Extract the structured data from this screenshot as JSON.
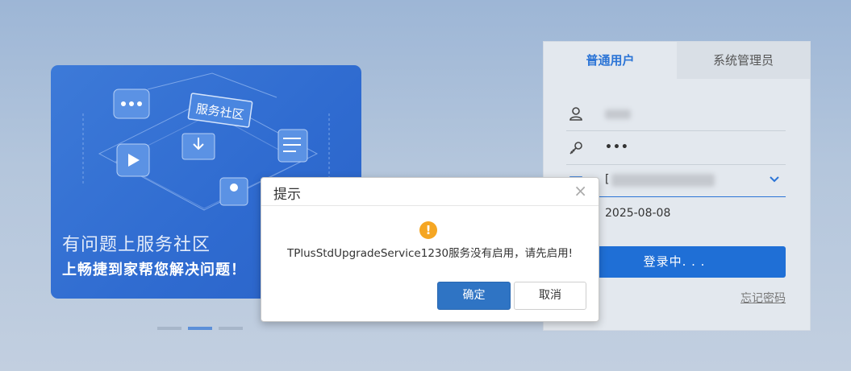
{
  "banner": {
    "badge_text": "服务社区",
    "title": "有问题上服务社区",
    "subtitle": "上畅捷到家帮您解决问题！"
  },
  "carousel": {
    "count": 3,
    "active_index": 1
  },
  "login": {
    "tabs": [
      {
        "label": "普通用户",
        "active": true
      },
      {
        "label": "系统管理员",
        "active": false
      }
    ],
    "username_value": "",
    "password_value": "•••",
    "account_value": "[",
    "date_value": "2025-08-08",
    "login_button": "登录中. . .",
    "forgot_password": "忘记密码"
  },
  "dialog": {
    "title": "提示",
    "close_symbol": "×",
    "icon": "warning-icon",
    "message": "TPlusStdUpgradeService1230服务没有启用，请先启用!",
    "ok_label": "确定",
    "cancel_label": "取消"
  },
  "colors": {
    "accent": "#2b74d6",
    "primary_button": "#1f6fd6",
    "dialog_ok": "#2f74c4",
    "warning": "#f5a623"
  }
}
